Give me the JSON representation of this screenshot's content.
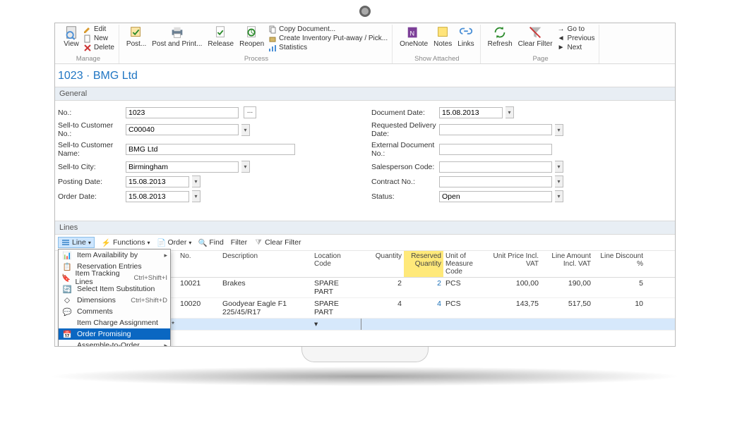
{
  "title": "1023 · BMG Ltd",
  "ribbon": {
    "view": "View",
    "edit": "Edit",
    "new": "New",
    "delete": "Delete",
    "manage": "Manage",
    "post": "Post...",
    "post_print": "Post and Print...",
    "release": "Release",
    "reopen": "Reopen",
    "copy_doc": "Copy Document...",
    "create_inv": "Create Inventory Put-away / Pick...",
    "statistics": "Statistics",
    "process": "Process",
    "onenote": "OneNote",
    "notes": "Notes",
    "links": "Links",
    "show_attached": "Show Attached",
    "refresh": "Refresh",
    "clear_filter": "Clear Filter",
    "go_to": "Go to",
    "previous": "Previous",
    "next": "Next",
    "page": "Page"
  },
  "general": {
    "header": "General",
    "no_label": "No.:",
    "no_value": "1023",
    "sell_cust_no_label": "Sell-to Customer No.:",
    "sell_cust_no_value": "C00040",
    "sell_cust_name_label": "Sell-to Customer Name:",
    "sell_cust_name_value": "BMG Ltd",
    "sell_city_label": "Sell-to City:",
    "sell_city_value": "Birmingham",
    "posting_date_label": "Posting Date:",
    "posting_date_value": "15.08.2013",
    "order_date_label": "Order Date:",
    "order_date_value": "15.08.2013",
    "document_date_label": "Document Date:",
    "document_date_value": "15.08.2013",
    "req_deliv_label": "Requested Delivery Date:",
    "req_deliv_value": "",
    "ext_doc_label": "External Document No.:",
    "ext_doc_value": "",
    "salesperson_label": "Salesperson Code:",
    "salesperson_value": "",
    "contract_label": "Contract No.:",
    "contract_value": "",
    "status_label": "Status:",
    "status_value": "Open"
  },
  "lines": {
    "header": "Lines",
    "toolbar": {
      "line": "Line",
      "functions": "Functions",
      "order": "Order",
      "find": "Find",
      "filter": "Filter",
      "clear_filter": "Clear Filter"
    },
    "submenu": {
      "item_avail": "Item Availability by",
      "reservation": "Reservation Entries",
      "tracking": "Item Tracking Lines",
      "tracking_sc": "Ctrl+Shift+I",
      "substitution": "Select Item Substitution",
      "dimensions": "Dimensions",
      "dimensions_sc": "Ctrl+Shift+D",
      "comments": "Comments",
      "charge": "Item Charge Assignment",
      "order_promising": "Order Promising",
      "assemble": "Assemble-to-Order"
    },
    "columns": {
      "no": "No.",
      "description": "Description",
      "location": "Location Code",
      "quantity": "Quantity",
      "reserved": "Reserved Quantity",
      "uom": "Unit of Measure Code",
      "unit_price": "Unit Price Incl. VAT",
      "line_amount": "Line Amount Incl. VAT",
      "line_discount": "Line Discount %"
    },
    "rows": [
      {
        "no": "10021",
        "description": "Brakes",
        "location": "SPARE PART",
        "quantity": "2",
        "reserved": "2",
        "uom": "PCS",
        "unit_price": "100,00",
        "line_amount": "190,00",
        "line_discount": "5"
      },
      {
        "no": "10020",
        "description": "Goodyear Eagle F1 225/45/R17",
        "location": "SPARE PART",
        "quantity": "4",
        "reserved": "4",
        "uom": "PCS",
        "unit_price": "143,75",
        "line_amount": "517,50",
        "line_discount": "10"
      }
    ]
  }
}
